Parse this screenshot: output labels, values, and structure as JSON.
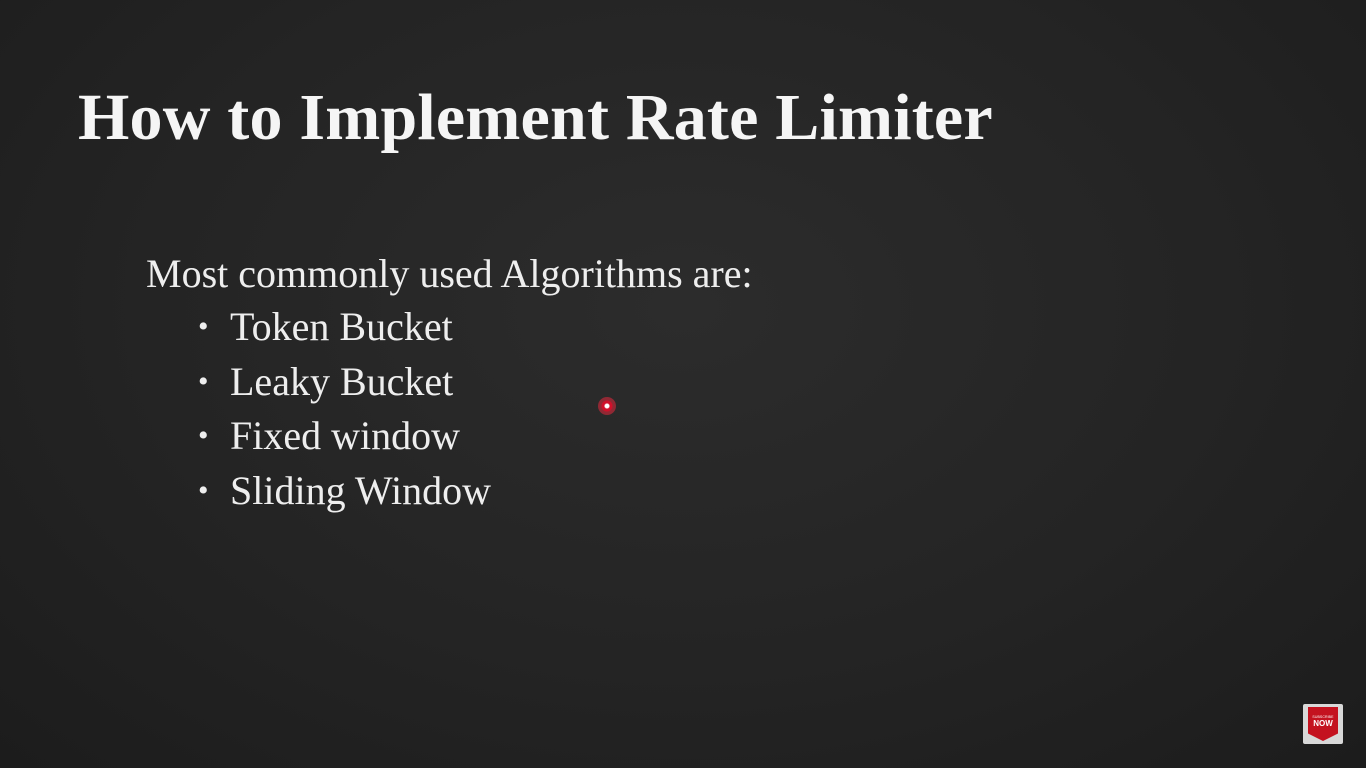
{
  "slide": {
    "title": "How to Implement Rate Limiter",
    "intro": "Most commonly used Algorithms are:",
    "bullets": [
      "Token Bucket",
      "Leaky Bucket",
      "Fixed window",
      "Sliding Window"
    ]
  },
  "badge": {
    "line1": "SUBSCRIBE",
    "line2": "NOW"
  },
  "colors": {
    "background": "#242424",
    "text": "#f2f2f2",
    "cursor": "#d0102a",
    "badge": "#c4121f"
  },
  "icons": {
    "cursor": "pointer-highlight-icon",
    "badge": "subscribe-badge-icon"
  }
}
